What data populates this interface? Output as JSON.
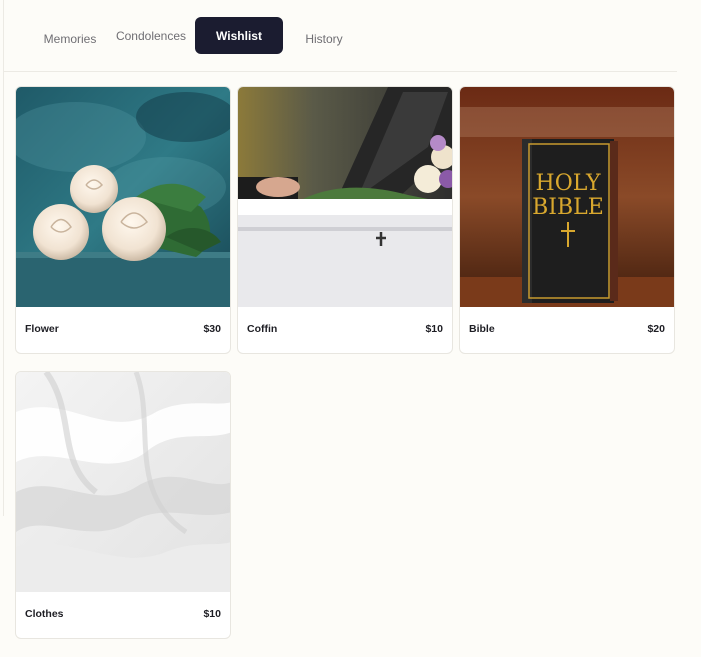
{
  "tabs": [
    {
      "label": "Memories",
      "active": false
    },
    {
      "label": "Condolences",
      "active": false
    },
    {
      "label": "Wishlist",
      "active": true
    },
    {
      "label": "History",
      "active": false
    }
  ],
  "wishlist": [
    {
      "name": "Flower",
      "price": "$30",
      "image": "white-roses-photo"
    },
    {
      "name": "Coffin",
      "price": "$10",
      "image": "white-coffin-photo"
    },
    {
      "name": "Bible",
      "price": "$20",
      "image": "holy-bible-photo",
      "image_text": [
        "HOLY",
        "BIBLE"
      ]
    },
    {
      "name": "Clothes",
      "price": "$10",
      "image": "white-cloth-photo"
    }
  ],
  "colors": {
    "active_tab": "#1b1c30",
    "background": "#fdfcf8"
  }
}
